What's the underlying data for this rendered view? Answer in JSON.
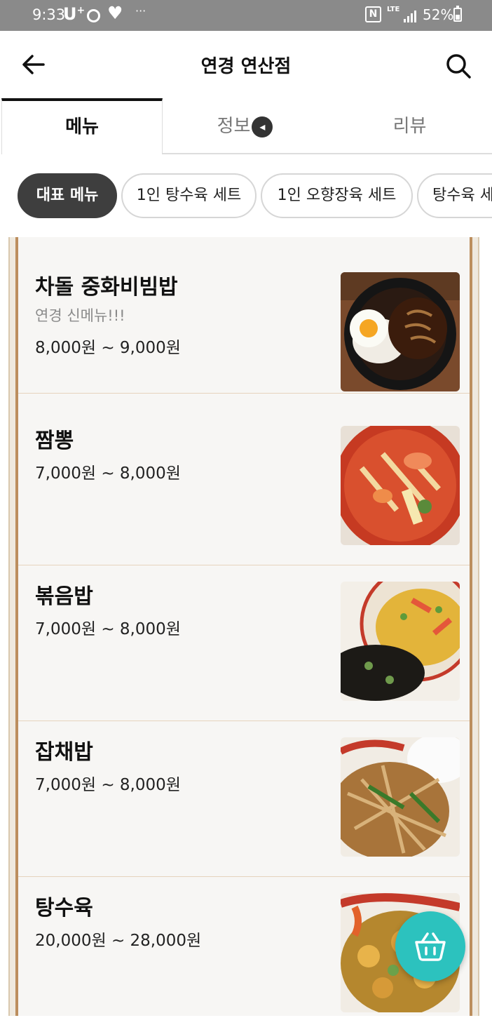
{
  "status_bar": {
    "time": "9:33",
    "carrier": "U",
    "carrier_sup": "+",
    "nfc": "N",
    "network": "LTE",
    "battery": "52%",
    "battery_level": 0.52
  },
  "header": {
    "title": "연경 연산점"
  },
  "tabs": [
    {
      "label": "메뉴",
      "active": true
    },
    {
      "label": "정보",
      "active": false
    },
    {
      "label": "리뷰",
      "active": false
    }
  ],
  "categories": [
    {
      "label": "대표 메뉴",
      "active": true
    },
    {
      "label": "1인 탕수육 세트",
      "active": false
    },
    {
      "label": "1인 오향장육 세트",
      "active": false
    },
    {
      "label": "탕수육 세",
      "active": false
    }
  ],
  "menu_items": [
    {
      "name": "차돌 중화비빔밥",
      "description": "연경 신메뉴!!!",
      "price": "8,000원 ~ 9,000원",
      "photo": "bibimbap-photo"
    },
    {
      "name": "짬뽕",
      "description": "",
      "price": "7,000원 ~ 8,000원",
      "photo": "jjamppong-photo"
    },
    {
      "name": "볶음밥",
      "description": "",
      "price": "7,000원 ~ 8,000원",
      "photo": "fried-rice-photo"
    },
    {
      "name": "잡채밥",
      "description": "",
      "price": "7,000원 ~ 8,000원",
      "photo": "japchae-rice-photo"
    },
    {
      "name": "탕수육",
      "description": "",
      "price": "20,000원 ~ 28,000원",
      "photo": "tangsuyuk-photo"
    }
  ],
  "cart": {
    "icon": "basket-icon"
  },
  "colors": {
    "accent": "#2cc2be",
    "frame": "#bc8e5e",
    "chip_active": "#3e3e3e"
  }
}
